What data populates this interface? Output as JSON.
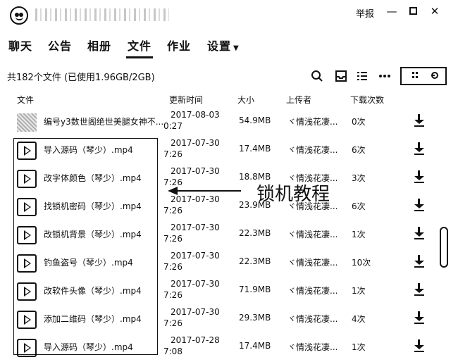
{
  "window": {
    "report_label": "举报",
    "min_label": "—",
    "close_label": "✕"
  },
  "tabs": [
    {
      "label": "聊天"
    },
    {
      "label": "公告"
    },
    {
      "label": "相册"
    },
    {
      "label": "文件",
      "active": true
    },
    {
      "label": "作业"
    },
    {
      "label": "设置"
    }
  ],
  "toolbar": {
    "summary": "共182个文件 (已使用1.96GB/2GB)"
  },
  "columns": {
    "file": "文件",
    "updated": "更新时间",
    "size": "大小",
    "uploader": "上传者",
    "downloads": "下载次数"
  },
  "files": [
    {
      "name": "编号y3数世阁绝世美腿女神不...",
      "date": "2017-08-03",
      "time": "0:27",
      "size": "54.9MB",
      "uploader": "ヾ情浅花凄...",
      "downloads": "0次",
      "type": "image"
    },
    {
      "name": "导入源码（琴少）.mp4",
      "date": "2017-07-30",
      "time": "7:26",
      "size": "17.4MB",
      "uploader": "ヾ情浅花凄...",
      "downloads": "6次",
      "type": "video"
    },
    {
      "name": "改字体颜色（琴少）.mp4",
      "date": "2017-07-30",
      "time": "7:26",
      "size": "18.8MB",
      "uploader": "ヾ情浅花凄...",
      "downloads": "3次",
      "type": "video"
    },
    {
      "name": "找锁机密码（琴少）.mp4",
      "date": "2017-07-30",
      "time": "7:26",
      "size": "23.9MB",
      "uploader": "ヾ情浅花凄...",
      "downloads": "6次",
      "type": "video"
    },
    {
      "name": "改锁机背景（琴少）.mp4",
      "date": "2017-07-30",
      "time": "7:26",
      "size": "22.3MB",
      "uploader": "ヾ情浅花凄...",
      "downloads": "1次",
      "type": "video"
    },
    {
      "name": "钓鱼盗号（琴少）.mp4",
      "date": "2017-07-30",
      "time": "7:26",
      "size": "22.3MB",
      "uploader": "ヾ情浅花凄...",
      "downloads": "10次",
      "type": "video"
    },
    {
      "name": "改软件头像（琴少）.mp4",
      "date": "2017-07-30",
      "time": "7:26",
      "size": "71.9MB",
      "uploader": "ヾ情浅花凄...",
      "downloads": "1次",
      "type": "video"
    },
    {
      "name": "添加二维码（琴少）.mp4",
      "date": "2017-07-30",
      "time": "7:26",
      "size": "29.3MB",
      "uploader": "ヾ情浅花凄...",
      "downloads": "4次",
      "type": "video"
    },
    {
      "name": "导入源码（琴少）.mp4",
      "date": "2017-07-28",
      "time": "7:08",
      "size": "17.4MB",
      "uploader": "ヾ情浅花凄...",
      "downloads": "1次",
      "type": "video"
    }
  ],
  "annotation": {
    "text": "锁机教程"
  }
}
